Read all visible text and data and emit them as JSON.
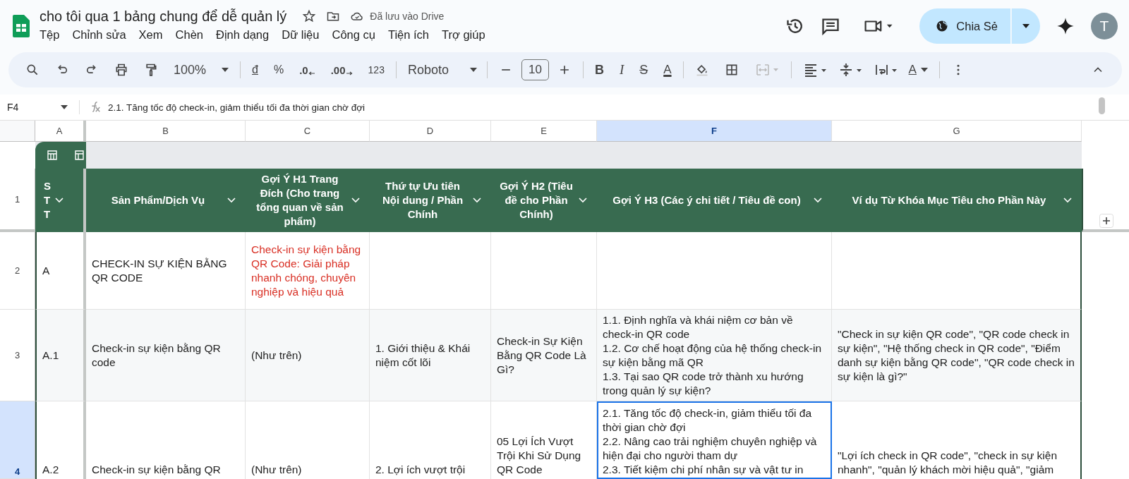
{
  "doc": {
    "title": "cho tôi qua 1 bảng chung để dễ quản lý",
    "save_status": "Đã lưu vào Drive"
  },
  "menu": [
    "Tệp",
    "Chỉnh sửa",
    "Xem",
    "Chèn",
    "Định dạng",
    "Dữ liệu",
    "Công cụ",
    "Tiện ích",
    "Trợ giúp"
  ],
  "share": {
    "label": "Chia Sẻ"
  },
  "avatar": {
    "initial": "T"
  },
  "toolbar": {
    "zoom": "100%",
    "currency": "đ",
    "percent": "%",
    "decrease_decimals": ".0",
    "increase_decimals": ".00",
    "number_format": "123",
    "font": "Roboto",
    "font_size": "10",
    "bold": "B",
    "italic": "I",
    "strikethrough": "S",
    "text_color": "A",
    "text_rotation": "A"
  },
  "formula_bar": {
    "cell_ref": "F4",
    "content": "2.1. Tăng tốc độ check-in, giảm thiểu tối đa thời gian chờ đợi"
  },
  "columns": [
    {
      "letter": "A",
      "selected": false
    },
    {
      "letter": "B",
      "selected": false
    },
    {
      "letter": "C",
      "selected": false
    },
    {
      "letter": "D",
      "selected": false
    },
    {
      "letter": "E",
      "selected": false
    },
    {
      "letter": "F",
      "selected": true
    },
    {
      "letter": "G",
      "selected": false
    }
  ],
  "table": {
    "header_row": "1",
    "headers": [
      "STT",
      "Sản Phẩm/Dịch Vụ",
      "Gợi Ý H1 Trang Đích (Cho trang tổng quan về sản phẩm)",
      "Thứ tự Ưu tiên Nội dung / Phần Chính",
      "Gợi Ý H2 (Tiêu đề cho Phần Chính)",
      "Gợi Ý H3 (Các ý chi tiết / Tiêu đề con)",
      "Ví dụ Từ Khóa Mục Tiêu cho Phần Này"
    ],
    "rows": [
      {
        "number": "2",
        "selected": false,
        "cells": [
          {
            "text": "A",
            "selected": false
          },
          {
            "text": "CHECK-IN SỰ KIỆN BẰNG QR CODE",
            "selected": false
          },
          {
            "text": "Check-in sự kiện bằng QR Code: Giải pháp nhanh chóng, chuyên nghiệp và hiệu quả",
            "selected": false,
            "color": "#d93025"
          },
          {
            "selected": false
          },
          {
            "selected": false
          },
          {
            "selected": false
          },
          {
            "selected": false
          }
        ]
      },
      {
        "number": "3",
        "selected": false,
        "cells": [
          {
            "text": "A.1",
            "selected": false
          },
          {
            "text": "Check-in sự kiện bằng QR code",
            "selected": false
          },
          {
            "text": "(Như trên)",
            "selected": false
          },
          {
            "text": "1. Giới thiệu & Khái niệm cốt lõi",
            "selected": false
          },
          {
            "text": "Check-in Sự Kiện Bằng QR Code Là Gì?",
            "selected": false
          },
          {
            "text": "1.1. Định nghĩa và khái niệm cơ bản về check-in QR code\n 1.2. Cơ chế hoạt động của hệ thống check-in sự kiện bằng mã QR\n1.3. Tại sao QR code trở thành xu hướng trong quản lý sự kiện?",
            "selected": false
          },
          {
            "text": "\"Check in sự kiện QR code\", \"QR code check in sự kiện\", \"Hệ thống check in QR code\", \"Điểm danh sự kiện bằng QR code\", \"QR code check in sự kiện là gì?\"",
            "selected": false
          }
        ]
      },
      {
        "number": "4",
        "selected": true,
        "cells": [
          {
            "text": "A.2",
            "selected": false
          },
          {
            "text": "Check-in sự kiện bằng QR",
            "selected": false
          },
          {
            "text": "(Như trên)",
            "selected": false
          },
          {
            "text": "2. Lợi ích vượt trội",
            "selected": false
          },
          {
            "text": "05 Lợi Ích Vượt Trội Khi Sử Dụng QR Code",
            "selected": false
          },
          {
            "text": "2.1. Tăng tốc độ check-in, giảm thiểu tối đa thời gian chờ đợi\n2.2. Nâng cao trải nghiệm chuyên nghiệp và hiện đại cho người tham dự\n2.3. Tiết kiệm chi phí nhân sự và vật tư in",
            "selected": true
          },
          {
            "text": "\"Lợi ích check in QR code\", \"check in sự kiện nhanh\", \"quản lý khách mời hiệu quả\", \"giảm",
            "selected": false
          }
        ]
      }
    ]
  }
}
